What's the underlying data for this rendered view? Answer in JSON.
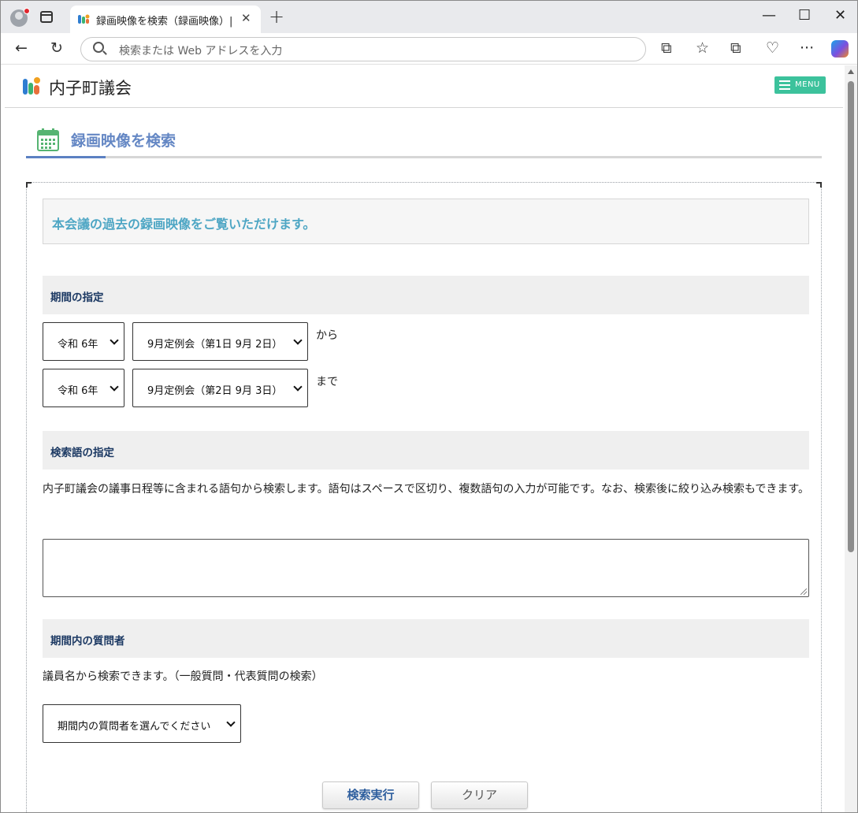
{
  "browser": {
    "tab_title": "録画映像を検索（録画映像）| 内子町議会",
    "tab_close": "✕",
    "new_tab": "+",
    "address_placeholder": "検索または Web アドレスを入力",
    "icons": [
      "back-icon",
      "refresh-icon",
      "split-screen-icon",
      "favorites-icon",
      "collections-icon",
      "browser-essentials-icon",
      "more-icon",
      "copilot-icon"
    ],
    "window_controls": {
      "minimize": "—",
      "maximize": "☐",
      "close": "✕"
    },
    "toolbar": {
      "back": "←",
      "refresh": "↻",
      "split": "⧉",
      "favorites": "☆",
      "collections": "⧉",
      "essentials": "♡",
      "more": "···"
    }
  },
  "site": {
    "name": "内子町議会",
    "menu_label": "MENU",
    "brand_colors": {
      "menu": "#3cc29c",
      "title": "#6487c4",
      "intro": "#4ea6c4"
    }
  },
  "page": {
    "title": "録画映像を検索",
    "intro": "本会議の過去の録画映像をご覧いただけます。",
    "period": {
      "heading": "期間の指定",
      "from": {
        "year": "令和 6年",
        "session": "9月定例会（第1日 9月 2日）",
        "suffix": "から"
      },
      "to": {
        "year": "令和 6年",
        "session": "9月定例会（第2日 9月 3日）",
        "suffix": "まで"
      }
    },
    "keyword": {
      "heading": "検索語の指定",
      "description": "内子町議会の議事日程等に含まれる語句から検索します。語句はスペースで区切り、複数語句の入力が可能です。なお、検索後に絞り込み検索もできます。",
      "value": ""
    },
    "questioner": {
      "heading": "期間内の質問者",
      "description": "議員名から検索できます。（一般質問・代表質問の検索）",
      "select": "期間内の質問者を選んでください"
    },
    "buttons": {
      "search": "検索実行",
      "clear": "クリア"
    }
  }
}
